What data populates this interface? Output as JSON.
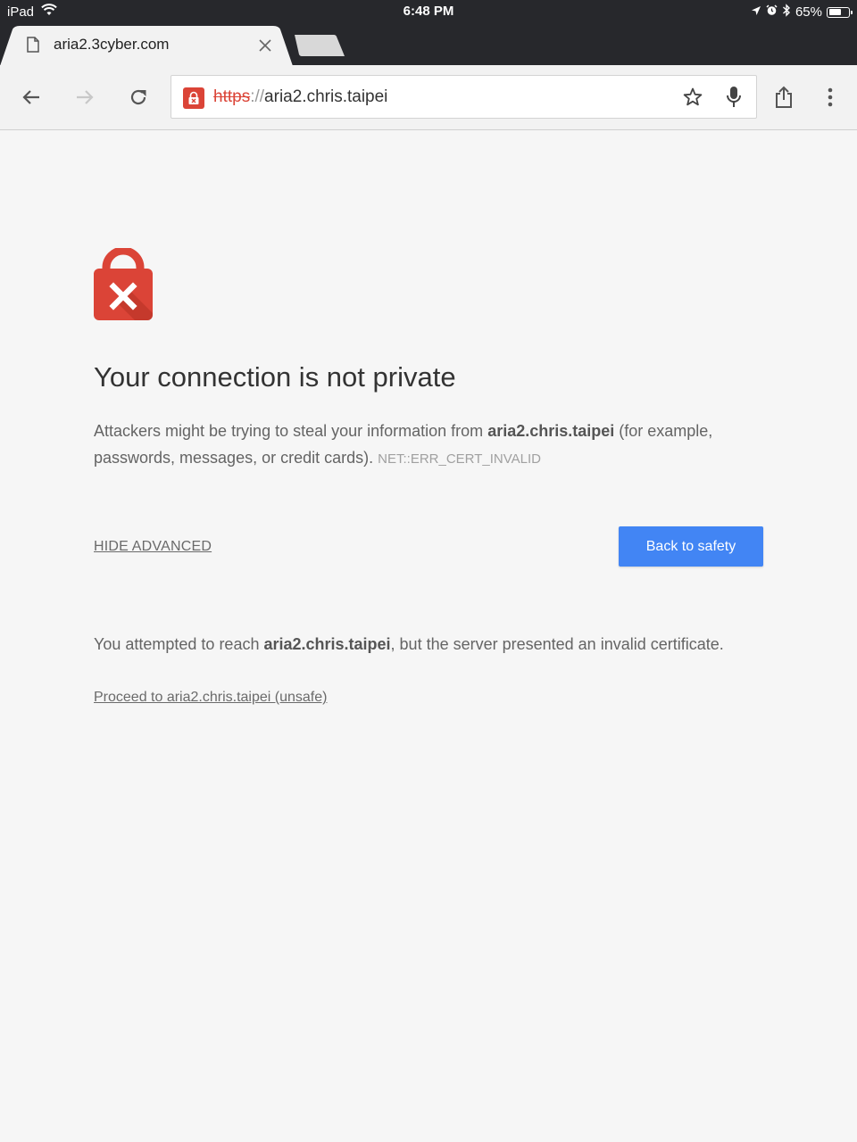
{
  "status_bar": {
    "carrier": "iPad",
    "time": "6:48 PM",
    "battery_text": "65%",
    "battery_level": 0.65
  },
  "tab": {
    "title": "aria2.3cyber.com"
  },
  "omnibox": {
    "scheme": "https",
    "separator": "://",
    "host": "aria2.chris.taipei"
  },
  "interstitial": {
    "heading": "Your connection is not private",
    "explanation_prefix": "Attackers might be trying to steal your information from ",
    "explanation_host": "aria2.chris.taipei",
    "explanation_suffix": " (for example, passwords, messages, or credit cards).",
    "error_code": "NET::ERR_CERT_INVALID",
    "hide_advanced": "HIDE ADVANCED",
    "back_button": "Back to safety",
    "details_prefix": "You attempted to reach ",
    "details_host": "aria2.chris.taipei",
    "details_suffix": ", but the server presented an invalid certificate.",
    "proceed_link": "Proceed to aria2.chris.taipei (unsafe)"
  },
  "colors": {
    "danger_red": "#db4437",
    "primary_blue": "#4285f4",
    "chrome_dark": "#27282c"
  }
}
